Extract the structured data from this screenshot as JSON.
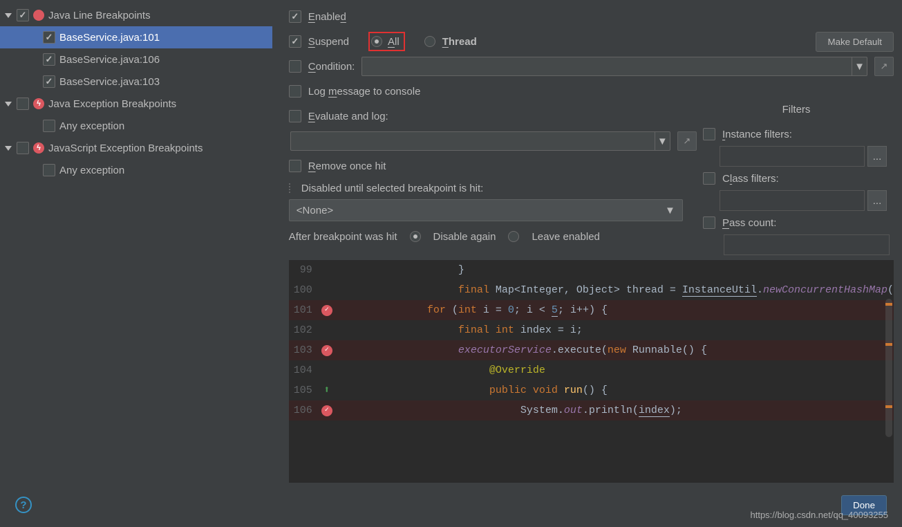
{
  "tree": {
    "groups": [
      {
        "label": "Java Line Breakpoints",
        "checked": true,
        "icon": "bp",
        "children": [
          {
            "label": "BaseService.java:101",
            "checked": true,
            "selected": true
          },
          {
            "label": "BaseService.java:106",
            "checked": true
          },
          {
            "label": "BaseService.java:103",
            "checked": true
          }
        ]
      },
      {
        "label": "Java Exception Breakpoints",
        "checked": false,
        "icon": "exc",
        "children": [
          {
            "label": "Any exception",
            "checked": false
          }
        ]
      },
      {
        "label": "JavaScript Exception Breakpoints",
        "checked": false,
        "icon": "exc",
        "children": [
          {
            "label": "Any exception",
            "checked": false
          }
        ]
      }
    ]
  },
  "opts": {
    "enabled": "Enabled",
    "suspend": "Suspend",
    "all": "All",
    "thread": "Thread",
    "make_default": "Make Default",
    "condition": "Condition:",
    "log": "Log message to console",
    "eval": "Evaluate and log:",
    "remove": "Remove once hit",
    "disabled_until": "Disabled until selected breakpoint is hit:",
    "none": "<None>",
    "after": "After breakpoint was hit",
    "disable_again": "Disable again",
    "leave": "Leave enabled",
    "filters": "Filters",
    "instance": "Instance filters:",
    "class": "Class filters:",
    "pass": "Pass count:"
  },
  "footer": {
    "done": "Done",
    "url": "https://blog.csdn.net/qq_40093255"
  },
  "code": {
    "lines": [
      {
        "n": 99,
        "bp": "",
        "html": "                   }"
      },
      {
        "n": 100,
        "bp": "",
        "html": "                   <span class='kw'>final</span> <span class='hl'>Map&lt;Integer, Object&gt; thread = <span class='cund'>InstanceUtil</span>.</span><span class='it'>newConcurrentHashMap</span>("
      },
      {
        "n": 101,
        "bp": "on",
        "html": "              <span class='kw'>for</span> (<span class='kw'>int</span> i = <span class='num'>0</span>; i &lt; <span class='cund num'>5</span>; i++) {",
        "hl": true
      },
      {
        "n": 102,
        "bp": "",
        "html": "                   <span class='kw'>final int</span> <span class='hl'>index = i;</span>"
      },
      {
        "n": 103,
        "bp": "on",
        "html": "                   <span class='it'>executorService</span>.<span class='hl'>execute(</span><span class='kw'>new</span> <span class='hl'>Runnable() {</span>",
        "hl": true
      },
      {
        "n": 104,
        "bp": "",
        "html": "                        <span class='ann'>@Override</span>"
      },
      {
        "n": 105,
        "bp": "up",
        "html": "                        <span class='kw'>public void</span> <span class='fn'>run</span><span class='hl'>() {</span>"
      },
      {
        "n": 106,
        "bp": "on",
        "html": "                             <span class='hl'>System.</span><span class='it'>out</span>.<span class='hl'>println(<span class='cund'>index</span>);</span>",
        "hl": true
      }
    ]
  }
}
